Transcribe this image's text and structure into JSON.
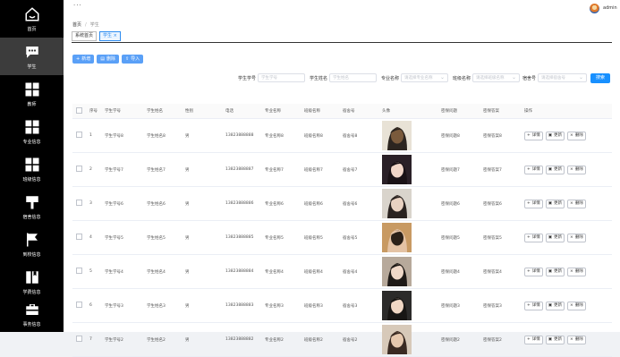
{
  "sidebar": {
    "items": [
      {
        "label": "首页",
        "icon": "home-icon"
      },
      {
        "label": "学生",
        "icon": "chat-icon",
        "active": true
      },
      {
        "label": "教师",
        "icon": "grid-icon"
      },
      {
        "label": "专业信息",
        "icon": "grid-icon"
      },
      {
        "label": "班级信息",
        "icon": "grid-icon"
      },
      {
        "label": "宿舍信息",
        "icon": "signboard-icon"
      },
      {
        "label": "到校信息",
        "icon": "flag-icon"
      },
      {
        "label": "学费信息",
        "icon": "book-icon"
      },
      {
        "label": "事务信息",
        "icon": "briefcase-icon"
      }
    ]
  },
  "topbar": {
    "dots": "···",
    "user_name": "admin"
  },
  "breadcrumb": {
    "home": "首页",
    "current": "学生"
  },
  "tabs": [
    {
      "label": "系统首页"
    },
    {
      "label": "学生 ×",
      "active": true
    }
  ],
  "toolbar": {
    "add_label": "新增",
    "delete_label": "删除",
    "import_label": "导入"
  },
  "search": {
    "student_no_label": "学生学号",
    "student_no_placeholder": "学生学号",
    "student_name_label": "学生姓名",
    "student_name_placeholder": "学生姓名",
    "major_label": "专业名称",
    "major_placeholder": "请选择专业名称",
    "class_label": "班级名称",
    "class_placeholder": "请选择班级名称",
    "dorm_label": "宿舍号",
    "dorm_placeholder": "请选择宿舍号",
    "search_button": "搜索"
  },
  "table": {
    "columns": [
      "序号",
      "学生学号",
      "学生姓名",
      "性别",
      "电话",
      "专业名称",
      "班级名称",
      "宿舍号",
      "头像",
      "密保问题",
      "密保答案",
      "操作"
    ],
    "actions": {
      "detail": "详情",
      "edit": "更新",
      "delete": "删除"
    },
    "rows": [
      {
        "index": "1",
        "student_no": "学生学号8",
        "name": "学生姓名8",
        "gender": "男",
        "phone": "13823888888",
        "major": "专业名称8",
        "class_name": "班级名称8",
        "dorm": "宿舍号8",
        "question": "密保问题8",
        "answer": "密保答案8",
        "thumb": "p1"
      },
      {
        "index": "2",
        "student_no": "学生学号7",
        "name": "学生姓名7",
        "gender": "男",
        "phone": "13823888887",
        "major": "专业名称7",
        "class_name": "班级名称7",
        "dorm": "宿舍号7",
        "question": "密保问题7",
        "answer": "密保答案7",
        "thumb": "p2"
      },
      {
        "index": "3",
        "student_no": "学生学号6",
        "name": "学生姓名6",
        "gender": "男",
        "phone": "13823888886",
        "major": "专业名称6",
        "class_name": "班级名称6",
        "dorm": "宿舍号6",
        "question": "密保问题6",
        "answer": "密保答案6",
        "thumb": "p3"
      },
      {
        "index": "4",
        "student_no": "学生学号5",
        "name": "学生姓名5",
        "gender": "男",
        "phone": "13823888885",
        "major": "专业名称5",
        "class_name": "班级名称5",
        "dorm": "宿舍号5",
        "question": "密保问题5",
        "answer": "密保答案5",
        "thumb": "p4"
      },
      {
        "index": "5",
        "student_no": "学生学号4",
        "name": "学生姓名4",
        "gender": "男",
        "phone": "13823888884",
        "major": "专业名称4",
        "class_name": "班级名称4",
        "dorm": "宿舍号4",
        "question": "密保问题4",
        "answer": "密保答案4",
        "thumb": "p5"
      },
      {
        "index": "6",
        "student_no": "学生学号3",
        "name": "学生姓名3",
        "gender": "男",
        "phone": "13823888883",
        "major": "专业名称3",
        "class_name": "班级名称3",
        "dorm": "宿舍号3",
        "question": "密保问题3",
        "answer": "密保答案3",
        "thumb": "p6"
      },
      {
        "index": "7",
        "student_no": "学生学号2",
        "name": "学生姓名2",
        "gender": "男",
        "phone": "13823888882",
        "major": "专业名称2",
        "class_name": "班级名称2",
        "dorm": "宿舍号2",
        "question": "密保问题2",
        "answer": "密保答案2",
        "thumb": "p7"
      }
    ]
  },
  "colors": {
    "sidebar_bg": "#000000",
    "sidebar_active": "#3c3c3c",
    "primary": "#1890ff",
    "toolbar_button": "#5aa0f7"
  }
}
